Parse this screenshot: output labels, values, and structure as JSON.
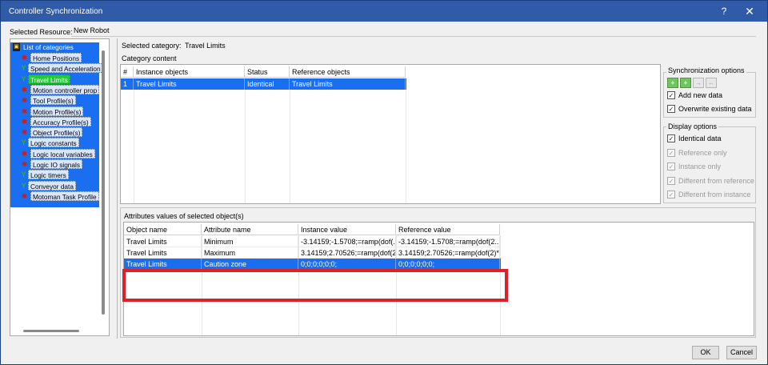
{
  "window": {
    "title": "Controller Synchronization",
    "help_label": "?",
    "close_label": "✕"
  },
  "resource": {
    "label": "Selected Resource:",
    "value": "New Robot"
  },
  "tree": {
    "root_label": "List of categories",
    "items": [
      {
        "label": "Home Positions",
        "icon": "red-robot-icon"
      },
      {
        "label": "Speed and Acceleration",
        "icon": "green-check-icon"
      },
      {
        "label": "Travel Limits",
        "icon": "green-check-icon",
        "selected": true
      },
      {
        "label": "Motion controller prop",
        "icon": "red-robot-icon"
      },
      {
        "label": "Tool Profile(s)",
        "icon": "red-robot-icon"
      },
      {
        "label": "Motion Profile(s)",
        "icon": "red-robot-icon"
      },
      {
        "label": "Accuracy Profile(s)",
        "icon": "red-robot-icon"
      },
      {
        "label": "Object Profile(s)",
        "icon": "red-robot-icon"
      },
      {
        "label": "Logic constants",
        "icon": "green-check-icon"
      },
      {
        "label": "Logic local variables",
        "icon": "red-robot-icon"
      },
      {
        "label": "Logic IO signals",
        "icon": "red-robot-icon"
      },
      {
        "label": "Logic timers",
        "icon": "green-check-icon"
      },
      {
        "label": "Conveyor data",
        "icon": "green-check-icon"
      },
      {
        "label": "Motoman Task Profile",
        "icon": "red-robot-icon"
      }
    ]
  },
  "category": {
    "label": "Selected category:",
    "value": "Travel Limits",
    "content_label": "Category content",
    "columns": [
      "#",
      "Instance objects",
      "Status",
      "Reference objects"
    ],
    "rows": [
      {
        "num": "1",
        "instance": "Travel Limits",
        "status": "Identical",
        "reference": "Travel Limits"
      }
    ]
  },
  "attributes": {
    "label": "Attributes values of selected object(s)",
    "columns": [
      "Object name",
      "Attribute name",
      "Instance value",
      "Reference value"
    ],
    "rows": [
      {
        "object": "Travel Limits",
        "attribute": "Minimum",
        "instance": "-3.14159;-1.5708;=ramp(dof(...",
        "reference": "-3.14159;-1.5708;=ramp(dof(2..."
      },
      {
        "object": "Travel Limits",
        "attribute": "Maximum",
        "instance": "3.14159;2.70526;=ramp(dof(2...",
        "reference": "3.14159;2.70526;=ramp(dof(2)*..."
      },
      {
        "object": "Travel Limits",
        "attribute": "Caution zone",
        "instance": "0;0;0;0;0;0;",
        "reference": "0;0;0;0;0;0;"
      }
    ]
  },
  "sync_options": {
    "title": "Synchronization options",
    "buttons": [
      "+",
      "+",
      "→",
      "←"
    ],
    "add_new_data": {
      "label": "Add new data",
      "checked": true
    },
    "overwrite": {
      "label": "Overwrite existing data",
      "checked": true
    }
  },
  "display_options": {
    "title": "Display options",
    "items": [
      {
        "label": "Identical data",
        "checked": true,
        "enabled": true
      },
      {
        "label": "Reference only",
        "checked": true,
        "enabled": false
      },
      {
        "label": "Instance only",
        "checked": true,
        "enabled": false
      },
      {
        "label": "Different from reference",
        "checked": true,
        "enabled": false
      },
      {
        "label": "Different from instance",
        "checked": true,
        "enabled": false
      }
    ]
  },
  "buttons": {
    "ok": "OK",
    "cancel": "Cancel"
  },
  "colors": {
    "title_bar": "#2f5ba8",
    "selection": "#1a6ff0",
    "tree_selected": "#25c93a",
    "highlight": "#e01f26"
  }
}
